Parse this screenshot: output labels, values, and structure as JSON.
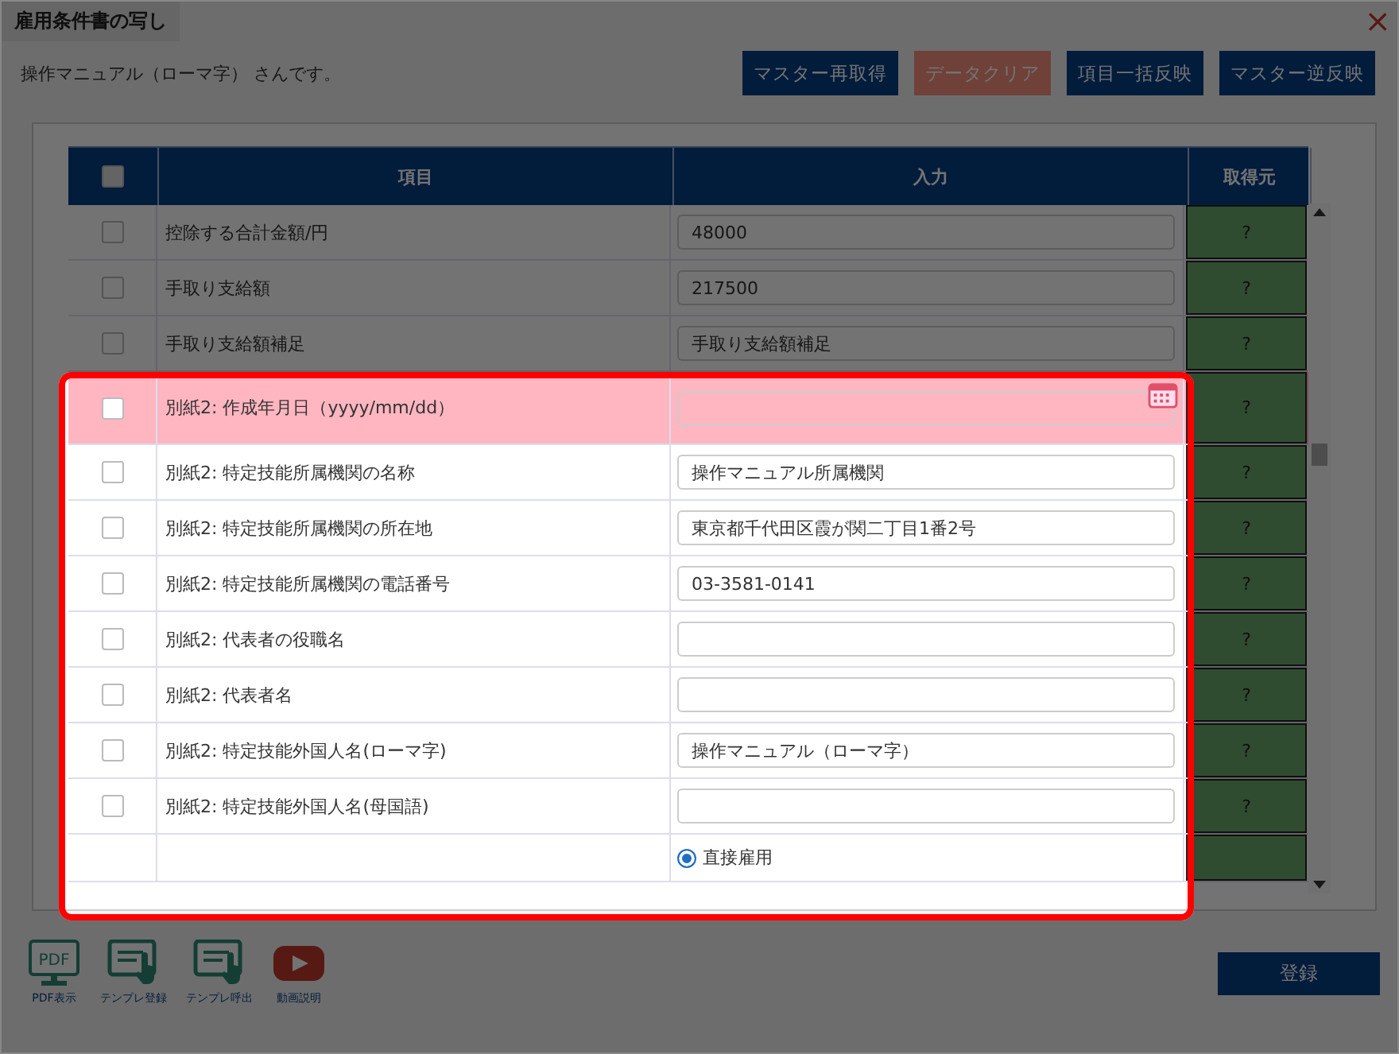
{
  "dialog": {
    "title": "雇用条件書の写し",
    "close": "×"
  },
  "message": "操作マニュアル（ローマ字） さんです。",
  "buttons": [
    {
      "label": "マスター再取得",
      "kind": "primary"
    },
    {
      "label": "データクリア",
      "kind": "danger"
    },
    {
      "label": "項目一括反映",
      "kind": "primary"
    },
    {
      "label": "マスター逆反映",
      "kind": "primary"
    }
  ],
  "table": {
    "header_checked": false,
    "columns": [
      "項目",
      "入力",
      "取得元"
    ],
    "rows": [
      {
        "checked": false,
        "item": "控除する合計金額/円",
        "kind": "text",
        "value": "48000",
        "source": "?",
        "invalid": false
      },
      {
        "checked": false,
        "item": "手取り支給額",
        "kind": "text",
        "value": "217500",
        "source": "?",
        "invalid": false
      },
      {
        "checked": false,
        "item": "手取り支給額補足",
        "kind": "text",
        "placeholder": "手取り支給額補足",
        "source": "?",
        "invalid": false
      },
      {
        "checked": false,
        "item": "別紙2: 作成年月日（yyyy/mm/dd）",
        "kind": "date",
        "source": "?",
        "invalid": true
      },
      {
        "checked": false,
        "item": "別紙2: 特定技能所属機関の名称",
        "kind": "text",
        "value": "操作マニュアル所属機関",
        "source": "?",
        "invalid": false
      },
      {
        "checked": false,
        "item": "別紙2: 特定技能所属機関の所在地",
        "kind": "text",
        "value": "東京都千代田区霞が関二丁目1番2号",
        "source": "?",
        "invalid": false
      },
      {
        "checked": false,
        "item": "別紙2: 特定技能所属機関の電話番号",
        "kind": "text",
        "value": "03-3581-0141",
        "source": "?",
        "invalid": false
      },
      {
        "checked": false,
        "item": "別紙2: 代表者の役職名",
        "kind": "text",
        "source": "?",
        "invalid": false
      },
      {
        "checked": false,
        "item": "別紙2: 代表者名",
        "kind": "text",
        "source": "?",
        "invalid": false
      },
      {
        "checked": false,
        "item": "別紙2: 特定技能外国人名(ローマ字)",
        "kind": "text",
        "value": "操作マニュアル（ローマ字）",
        "source": "?",
        "invalid": false
      },
      {
        "checked": false,
        "item": "別紙2: 特定技能外国人名(母国語)",
        "kind": "text",
        "source": "?",
        "invalid": false
      },
      {
        "kind": "radio",
        "options": [
          {
            "label": "直接雇用",
            "selected": true
          }
        ]
      }
    ]
  },
  "tools": [
    {
      "label": "PDF表示",
      "kind": "pdf",
      "icon_text": "PDF"
    },
    {
      "label": "テンプレ登録",
      "kind": "template"
    },
    {
      "label": "テンプレ呼出",
      "kind": "template"
    },
    {
      "label": "動画説明",
      "kind": "video"
    }
  ],
  "submit": "登録"
}
